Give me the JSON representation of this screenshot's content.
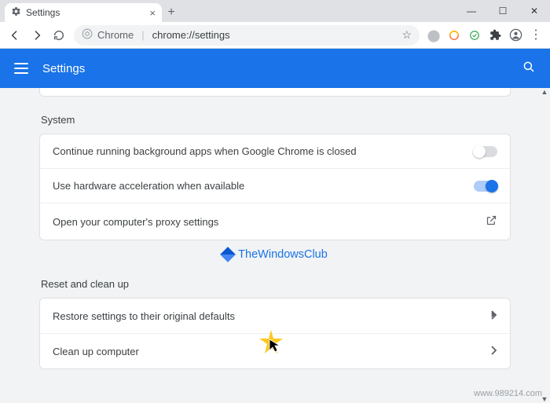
{
  "tab": {
    "title": "Settings"
  },
  "omnibox": {
    "prefix": "Chrome",
    "url": "chrome://settings"
  },
  "header": {
    "title": "Settings"
  },
  "sections": {
    "system": {
      "label": "System",
      "bg_apps": "Continue running background apps when Google Chrome is closed",
      "hw_accel": "Use hardware acceleration when available",
      "proxy": "Open your computer's proxy settings"
    },
    "reset": {
      "label": "Reset and clean up",
      "restore": "Restore settings to their original defaults",
      "cleanup": "Clean up computer"
    }
  },
  "watermark": "TheWindowsClub",
  "footer": "www.989214.com"
}
